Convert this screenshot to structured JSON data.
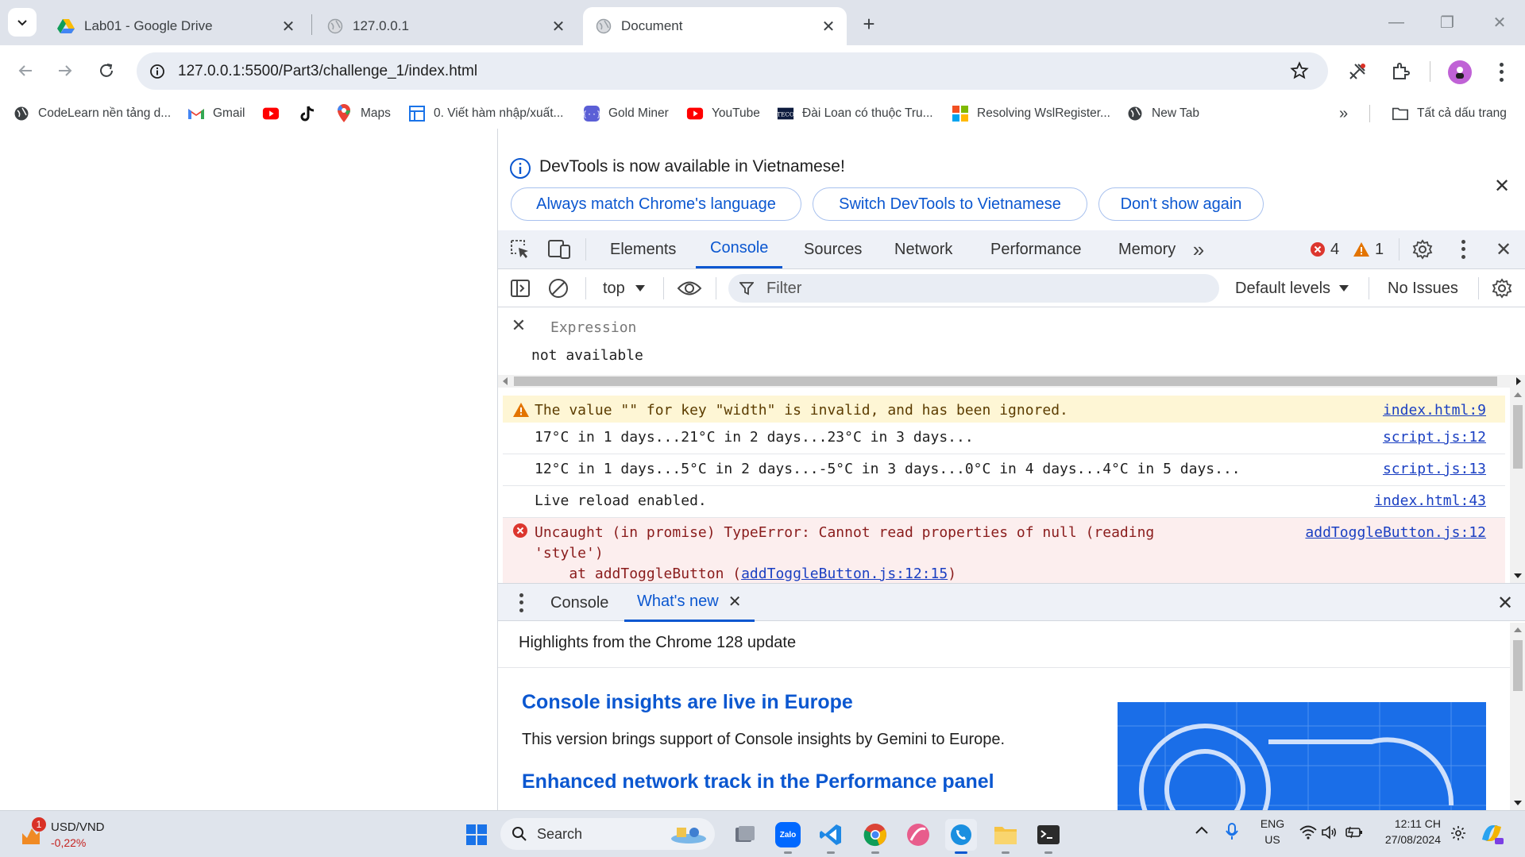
{
  "tabs": [
    {
      "title": "Lab01 - Google Drive",
      "icon": "google-drive-icon"
    },
    {
      "title": "127.0.0.1",
      "icon": "globe-icon"
    },
    {
      "title": "Document",
      "icon": "globe-icon",
      "active": true
    }
  ],
  "address_bar": {
    "url": "127.0.0.1:5500/Part3/challenge_1/index.html"
  },
  "bookmarks": [
    {
      "label": "CodeLearn nền tảng d...",
      "icon": "globe-icon"
    },
    {
      "label": "Gmail",
      "icon": "gmail-icon"
    },
    {
      "label": "",
      "icon": "youtube-icon"
    },
    {
      "label": "",
      "icon": "tiktok-icon"
    },
    {
      "label": "Maps",
      "icon": "maps-icon"
    },
    {
      "label": "0. Viết hàm nhập/xuất...",
      "icon": "doc-icon"
    },
    {
      "label": "Gold Miner",
      "icon": "game-icon"
    },
    {
      "label": "YouTube",
      "icon": "youtube-icon"
    },
    {
      "label": "Đài Loan có thuộc Tru...",
      "icon": "news-icon"
    },
    {
      "label": "Resolving WslRegister...",
      "icon": "microsoft-icon"
    },
    {
      "label": "New Tab",
      "icon": "globe-icon"
    }
  ],
  "all_bookmarks_label": "Tất cả dấu trang",
  "devtools": {
    "infobar": {
      "message": "DevTools is now available in Vietnamese!",
      "buttons": [
        "Always match Chrome's language",
        "Switch DevTools to Vietnamese",
        "Don't show again"
      ]
    },
    "tabs": [
      "Elements",
      "Console",
      "Sources",
      "Network",
      "Performance",
      "Memory"
    ],
    "active_tab": "Console",
    "error_count": "4",
    "warning_count": "1",
    "context": "top",
    "filter_placeholder": "Filter",
    "levels": "Default levels",
    "issues": "No Issues",
    "live_expression": {
      "placeholder": "Expression",
      "value": "not available"
    },
    "messages": [
      {
        "type": "warning",
        "text": "The value \"\" for key \"width\" is invalid, and has been ignored.",
        "source": "index.html:9"
      },
      {
        "type": "log",
        "text": "17°C in 1 days...21°C in 2 days...23°C in 3 days...",
        "source": "script.js:12"
      },
      {
        "type": "log",
        "text": "12°C in 1 days...5°C in 2 days...-5°C in 3 days...0°C in 4 days...4°C in 5 days...",
        "source": "script.js:13"
      },
      {
        "type": "log",
        "text": "Live reload enabled.",
        "source": "index.html:43"
      },
      {
        "type": "error",
        "text": "Uncaught (in promise) TypeError: Cannot read properties of null (reading",
        "text2": "'style')",
        "text3": "    at addToggleButton (",
        "text3_link": "addToggleButton.js:12:15",
        "text3_end": ")",
        "source": "addToggleButton.js:12"
      }
    ],
    "drawer": {
      "tabs": [
        "Console",
        "What's new"
      ],
      "active_tab": "What's new",
      "header": "Highlights from the Chrome 128 update",
      "article1_title": "Console insights are live in Europe",
      "article1_body": "This version brings support of Console insights by Gemini to Europe.",
      "article2_title": "Enhanced network track in the Performance panel"
    }
  },
  "taskbar": {
    "currency_pair": "USD/VND",
    "currency_change": "-0,22%",
    "widget_badge": "1",
    "search_label": "Search",
    "zalo_label": "Zalo",
    "lang_line1": "ENG",
    "lang_line2": "US",
    "time": "12:11 CH",
    "date": "27/08/2024",
    "colors": {
      "accent": "#0b57d0",
      "error": "#dc362e",
      "warning": "#e37400"
    }
  }
}
